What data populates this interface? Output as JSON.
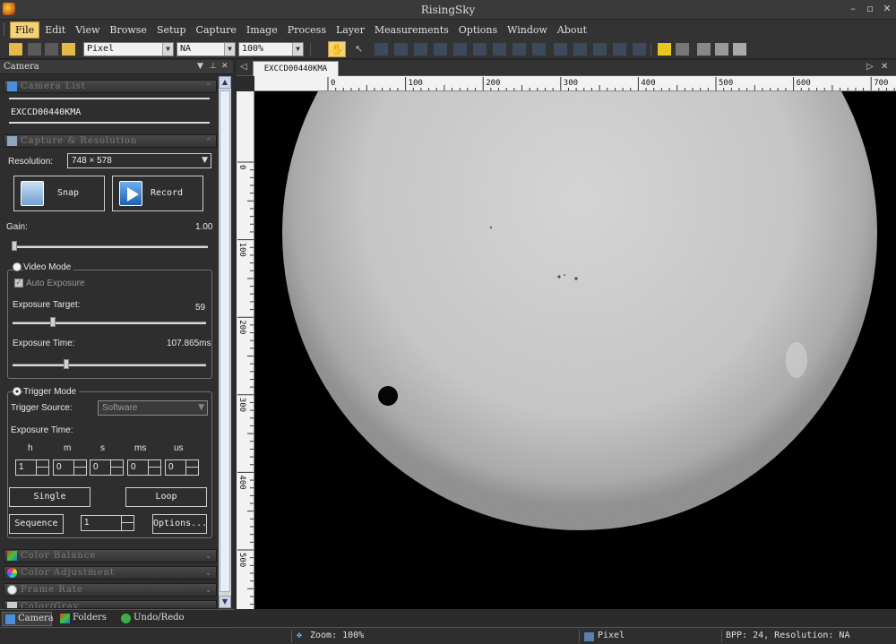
{
  "window": {
    "title": "RisingSky"
  },
  "menu": [
    "File",
    "Edit",
    "View",
    "Browse",
    "Setup",
    "Capture",
    "Image",
    "Process",
    "Layer",
    "Measurements",
    "Options",
    "Window",
    "About"
  ],
  "toolbar": {
    "units": "Pixel",
    "na": "NA",
    "zoom": "100%"
  },
  "panel": {
    "title": "Camera",
    "camera_list": {
      "header": "Camera List",
      "camera": "EXCCD00440KMA"
    },
    "capture": {
      "header": "Capture & Resolution",
      "resolution_label": "Resolution:",
      "resolution": "748 × 578",
      "snap": "Snap",
      "record": "Record"
    },
    "gain": {
      "label": "Gain:",
      "value": "1.00",
      "fraction": 0.0
    },
    "video_mode": {
      "label": "Video Mode",
      "auto_exposure": "Auto Exposure",
      "target_label": "Exposure Target:",
      "target_value": "59",
      "target_fraction": 0.2,
      "time_label": "Exposure Time:",
      "time_value": "107.865ms",
      "time_fraction": 0.27
    },
    "trigger_mode": {
      "label": "Trigger Mode",
      "source_label": "Trigger Source:",
      "source": "Software",
      "time_label": "Exposure Time:",
      "units": [
        "h",
        "m",
        "s",
        "ms",
        "us"
      ],
      "values": [
        "1",
        "0",
        "0",
        "0",
        "0"
      ],
      "single": "Single",
      "loop": "Loop",
      "sequence": "Sequence",
      "sequence_count": "1",
      "options": "Options..."
    },
    "collapsed_sections": [
      "Color Balance",
      "Color Adjustment",
      "Frame Rate",
      "Color/Gray"
    ],
    "tabs": [
      "Camera",
      "Folders",
      "Undo/Redo"
    ]
  },
  "document": {
    "tab": "EXCCD00440KMA",
    "hruler": [
      "0",
      "100",
      "200",
      "300",
      "400",
      "500",
      "600",
      "700"
    ],
    "vruler": [
      "0",
      "100",
      "200",
      "300",
      "400",
      "500"
    ]
  },
  "status": {
    "zoom": "Zoom: 100%",
    "units": "Pixel",
    "info": "BPP: 24, Resolution: NA"
  },
  "colors": {
    "accent": "#f4d27a",
    "panel": "#2e2e2e",
    "sun": "#cfcfcf"
  }
}
